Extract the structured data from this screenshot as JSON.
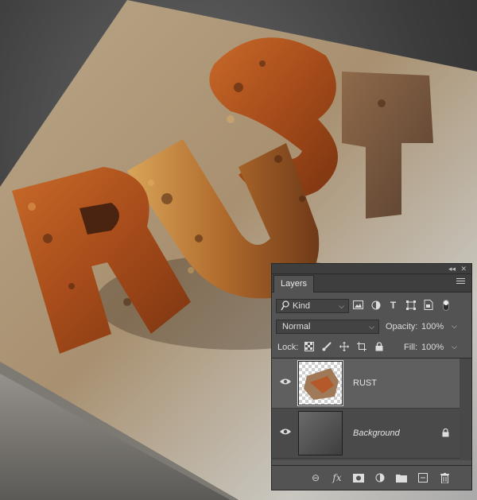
{
  "panel": {
    "title": "Layers",
    "filter": {
      "kind_label": "Kind"
    },
    "blend_mode": "Normal",
    "opacity_label": "Opacity:",
    "opacity_value": "100%",
    "lock_label": "Lock:",
    "fill_label": "Fill:",
    "fill_value": "100%",
    "layers": [
      {
        "name": "RUST",
        "visible": true,
        "selected": true
      },
      {
        "name": "Background",
        "visible": true,
        "locked": true
      }
    ]
  },
  "scene": {
    "text": "RUST"
  }
}
